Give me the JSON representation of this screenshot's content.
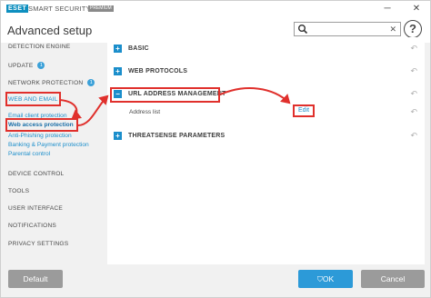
{
  "titlebar": {
    "logo": "ESET",
    "app_name": "SMART SECURITY",
    "tag": "PREMIUM",
    "minimize": "─",
    "close": "✕"
  },
  "header": {
    "title": "Advanced setup",
    "search_value": "",
    "search_clear": "✕",
    "help": "?"
  },
  "sidebar": {
    "items": [
      {
        "label": "DETECTION ENGINE"
      },
      {
        "label": "UPDATE",
        "badge": "1"
      },
      {
        "label": "NETWORK PROTECTION",
        "badge": "1"
      },
      {
        "label": "WEB AND EMAIL"
      },
      {
        "label": "DEVICE CONTROL"
      },
      {
        "label": "TOOLS"
      },
      {
        "label": "USER INTERFACE"
      },
      {
        "label": "NOTIFICATIONS"
      },
      {
        "label": "PRIVACY SETTINGS"
      }
    ],
    "subitems": [
      {
        "label": "Email client protection"
      },
      {
        "label": "Web access protection"
      },
      {
        "label": "Anti-Phishing protection"
      },
      {
        "label": "Banking & Payment protection"
      },
      {
        "label": "Parental control"
      }
    ]
  },
  "main": {
    "sections": [
      {
        "label": "BASIC",
        "toggle": "+",
        "reset": "↶"
      },
      {
        "label": "WEB PROTOCOLS",
        "toggle": "+",
        "reset": "↶"
      },
      {
        "label": "URL ADDRESS MANAGEMENT",
        "toggle": "−",
        "reset": "↶"
      },
      {
        "label": "THREATSENSE PARAMETERS",
        "toggle": "+",
        "reset": "↶"
      }
    ],
    "address_list_label": "Address list",
    "edit_label": "Edit",
    "row_reset": "↶"
  },
  "footer": {
    "default_label": "Default",
    "ok_label": "OK",
    "cancel_label": "Cancel"
  },
  "colors": {
    "accent": "#1b8ecb",
    "highlight": "#e0302c",
    "button_gray": "#9b9b9b",
    "button_blue": "#2c9ad8"
  }
}
